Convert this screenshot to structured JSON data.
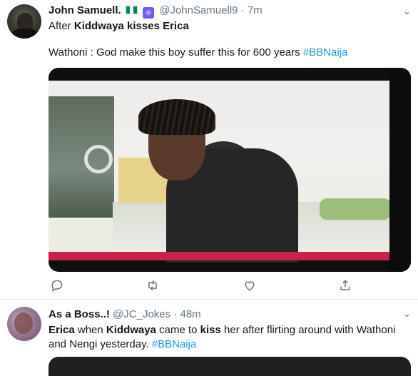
{
  "tweets": [
    {
      "author": {
        "name": "John Samuell.",
        "handle": "@JohnSamuell9",
        "badge": "⚛",
        "flag_colors": [
          "#008751",
          "#ffffff"
        ]
      },
      "time": "7m",
      "separator": "·",
      "lines": [
        {
          "parts": [
            {
              "t": "After "
            },
            {
              "t": "Kiddwaya kisses Erica",
              "b": true
            }
          ]
        },
        {
          "parts": [
            {
              "t": "Wathoni : God make this boy suffer this for 600 years "
            },
            {
              "t": "#BBNaija",
              "tag": true
            }
          ]
        }
      ],
      "actions": {
        "reply": "reply-icon",
        "retweet": "retweet-icon",
        "like": "heart-icon",
        "share": "share-icon"
      }
    },
    {
      "author": {
        "name": "As a Boss..!",
        "handle": "@JC_Jokes"
      },
      "time": "48m",
      "separator": "·",
      "lines": [
        {
          "parts": [
            {
              "t": "Erica",
              "b": true
            },
            {
              "t": " when "
            },
            {
              "t": "Kiddwaya",
              "b": true
            },
            {
              "t": " came to "
            },
            {
              "t": "kiss",
              "b": true
            },
            {
              "t": " her after flirting around with Wathoni and Nengi yesterday. "
            },
            {
              "t": "#BBNaija",
              "tag": true
            }
          ]
        }
      ]
    }
  ],
  "colors": {
    "text": "#14171a",
    "meta": "#657786",
    "link": "#1b95e0",
    "divider": "#e6ecf0"
  }
}
